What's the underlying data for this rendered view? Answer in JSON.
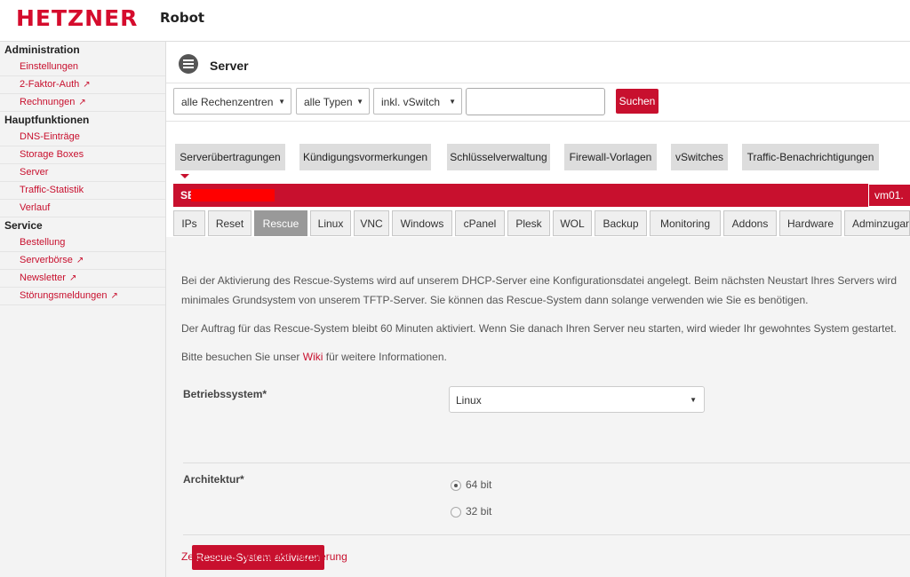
{
  "header": {
    "logo": "HETZNER",
    "product": "Robot"
  },
  "sidebar": {
    "groups": [
      {
        "title": "Administration",
        "items": [
          {
            "label": "Einstellungen",
            "external": false
          },
          {
            "label": "2-Faktor-Auth",
            "external": true
          },
          {
            "label": "Rechnungen",
            "external": true
          }
        ]
      },
      {
        "title": "Hauptfunktionen",
        "items": [
          {
            "label": "DNS-Einträge",
            "external": false
          },
          {
            "label": "Storage Boxes",
            "external": false
          },
          {
            "label": "Server",
            "external": false
          },
          {
            "label": "Traffic-Statistik",
            "external": false
          },
          {
            "label": "Verlauf",
            "external": false
          }
        ]
      },
      {
        "title": "Service",
        "items": [
          {
            "label": "Bestellung",
            "external": false
          },
          {
            "label": "Serverbörse",
            "external": true
          },
          {
            "label": "Newsletter",
            "external": true
          },
          {
            "label": "Störungsmeldungen",
            "external": true
          }
        ]
      }
    ]
  },
  "page": {
    "title": "Server",
    "icon": "server-list-icon"
  },
  "filters": {
    "datacenter": "alle Rechenzentren",
    "type": "alle Typen",
    "vswitch": "inkl. vSwitch",
    "search_value": "",
    "search_button": "Suchen"
  },
  "tools": [
    "Serverübertragungen",
    "Kündigungsvormerkungen",
    "Schlüsselverwaltung",
    "Firewall-Vorlagen",
    "vSwitches",
    "Traffic-Benachrichtigungen"
  ],
  "server": {
    "id_prefix": "SB",
    "vm_label": "vm01."
  },
  "tabs": [
    "IPs",
    "Reset",
    "Rescue",
    "Linux",
    "VNC",
    "Windows",
    "cPanel",
    "Plesk",
    "WOL",
    "Backup",
    "Monitoring",
    "Addons",
    "Hardware",
    "Adminzugang"
  ],
  "active_tab": "Rescue",
  "rescue": {
    "para1_line1": "Bei der Aktivierung des Rescue-Systems wird auf unserem DHCP-Server eine Konfigurationsdatei angelegt. Beim nächsten Neustart Ihres Servers wird",
    "para1_line2": "minimales Grundsystem von unserem TFTP-Server. Sie können das Rescue-System dann solange verwenden wie Sie es benötigen.",
    "para2": "Der Auftrag für das Rescue-System bleibt 60 Minuten aktiviert. Wenn Sie danach Ihren Server neu starten, wird wieder Ihr gewohntes System gestartet.",
    "para3_before": "Bitte besuchen Sie unser ",
    "para3_link": "Wiki",
    "para3_after": " für weitere Informationen.",
    "os_label": "Betriebssystem*",
    "os_value": "Linux",
    "arch_label": "Architektur*",
    "arch_option1": "64 bit",
    "arch_option2": "32 bit",
    "arch_selected": "64 bit",
    "activate_button": "Rescue-System aktivieren",
    "last_activation_link": "Zeige Daten der letzten Aktivierung"
  },
  "colors": {
    "brand_red": "#c8102e",
    "redaction": "#ff0000"
  }
}
